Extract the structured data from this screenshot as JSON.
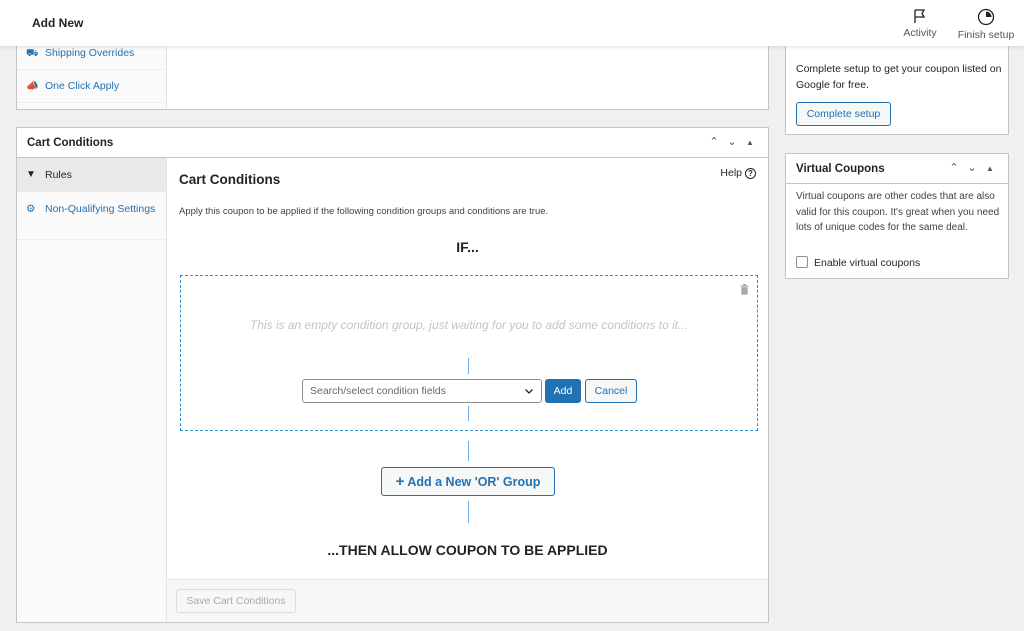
{
  "topbar": {
    "title": "Add New",
    "activity_label": "Activity",
    "finish_setup_label": "Finish setup"
  },
  "upper_nav": {
    "items": [
      {
        "label": "Shipping Overrides",
        "icon": "truck-icon"
      },
      {
        "label": "One Click Apply",
        "icon": "megaphone-icon"
      }
    ]
  },
  "cart_conditions": {
    "panel_title": "Cart Conditions",
    "nav": [
      {
        "label": "Rules",
        "icon": "filter-icon"
      },
      {
        "label": "Non-Qualifying Settings",
        "icon": "gear-icon"
      }
    ],
    "heading": "Cart Conditions",
    "help_label": "Help",
    "description": "Apply this coupon to be applied if the following condition groups and conditions are true.",
    "if_label": "IF...",
    "empty_group_text": "This is an empty condition group, just waiting for you to add some conditions to it...",
    "select_placeholder": "Search/select condition fields",
    "add_label": "Add",
    "cancel_label": "Cancel",
    "add_or_group_label": "Add a New 'OR' Group",
    "then_label": "...THEN ALLOW COUPON TO BE APPLIED",
    "save_label": "Save Cart Conditions"
  },
  "setup_panel": {
    "text": "Complete setup to get your coupon listed on Google for free.",
    "button_label": "Complete setup"
  },
  "virtual_coupons": {
    "title": "Virtual Coupons",
    "description": "Virtual coupons are other codes that are also valid for this coupon. It's great when you need lots of unique codes for the same deal.",
    "checkbox_label": "Enable virtual coupons",
    "checkbox_checked": false
  },
  "colors": {
    "accent": "#2271b1",
    "dashed_border": "#2e8fc4",
    "connector": "#72aee6"
  }
}
